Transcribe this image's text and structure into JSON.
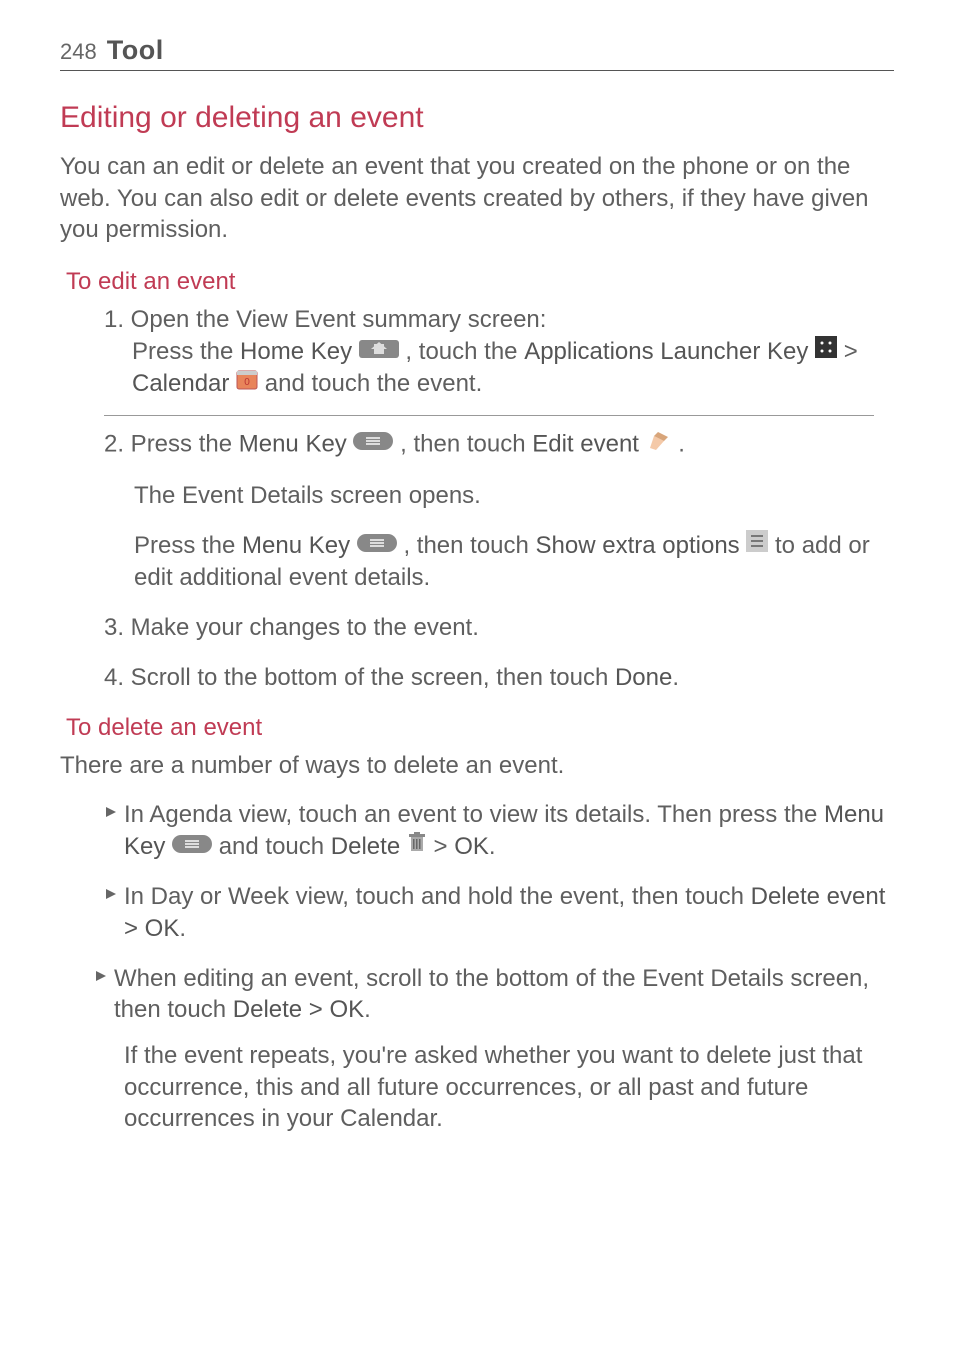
{
  "page_number": "248",
  "header_title": "Tool",
  "h2_editing": "Editing or deleting an event",
  "intro": "You can an edit or delete an event that you created on the phone or on the web. You can also edit or delete events created by others, if they have given you permission.",
  "h3_edit": "To edit an event",
  "step1_l1_a": "1. Open the View Event summary screen:",
  "step1_l2_a": "Press the ",
  "step1_l2_home_key": "Home Key",
  "step1_l2_b": " , touch the ",
  "step1_l2_apps": "Applications Launcher Key",
  "step1_l2_gt": " > ",
  "step1_l2_cal": "Calendar",
  "step1_l2_c": " and touch the event.",
  "step2_a": "2. Press the ",
  "step2_menu": "Menu Key",
  "step2_b": " , then touch ",
  "step2_edit": "Edit event",
  "step2_c": " .",
  "step2_sub1": "The Event Details screen opens.",
  "step2_sub2_a": "Press the ",
  "step2_sub2_menu": "Menu Key",
  "step2_sub2_b": " , then touch ",
  "step2_sub2_extra": "Show extra options",
  "step2_sub2_c": " to add or edit additional event details.",
  "step3": "3. Make your changes to the event.",
  "step4_a": "4. Scroll to the bottom of the screen, then touch ",
  "step4_done": "Done",
  "step4_b": ".",
  "h3_delete": "To delete an event",
  "delete_intro": "There are a number of ways to delete an event.",
  "b1_a": "In Agenda view, touch an event to view its details. Then press the ",
  "b1_menu": "Menu Key",
  "b1_b": " and touch ",
  "b1_delete": "Delete",
  "b1_gt": " > ",
  "b1_ok": "OK",
  "b1_c": ".",
  "b2_a": "In Day or Week view, touch and hold the event, then touch ",
  "b2_del_ok": "Delete event > OK",
  "b2_b": ".",
  "b3_a": "When editing an event, scroll to the bottom of the Event Details screen, then touch ",
  "b3_del_ok": "Delete > OK",
  "b3_b": ".",
  "b3_sub": "If the event repeats, you're asked whether you want to delete just that occurrence, this and all future occurrences, or all past and future occurrences in your Calendar."
}
